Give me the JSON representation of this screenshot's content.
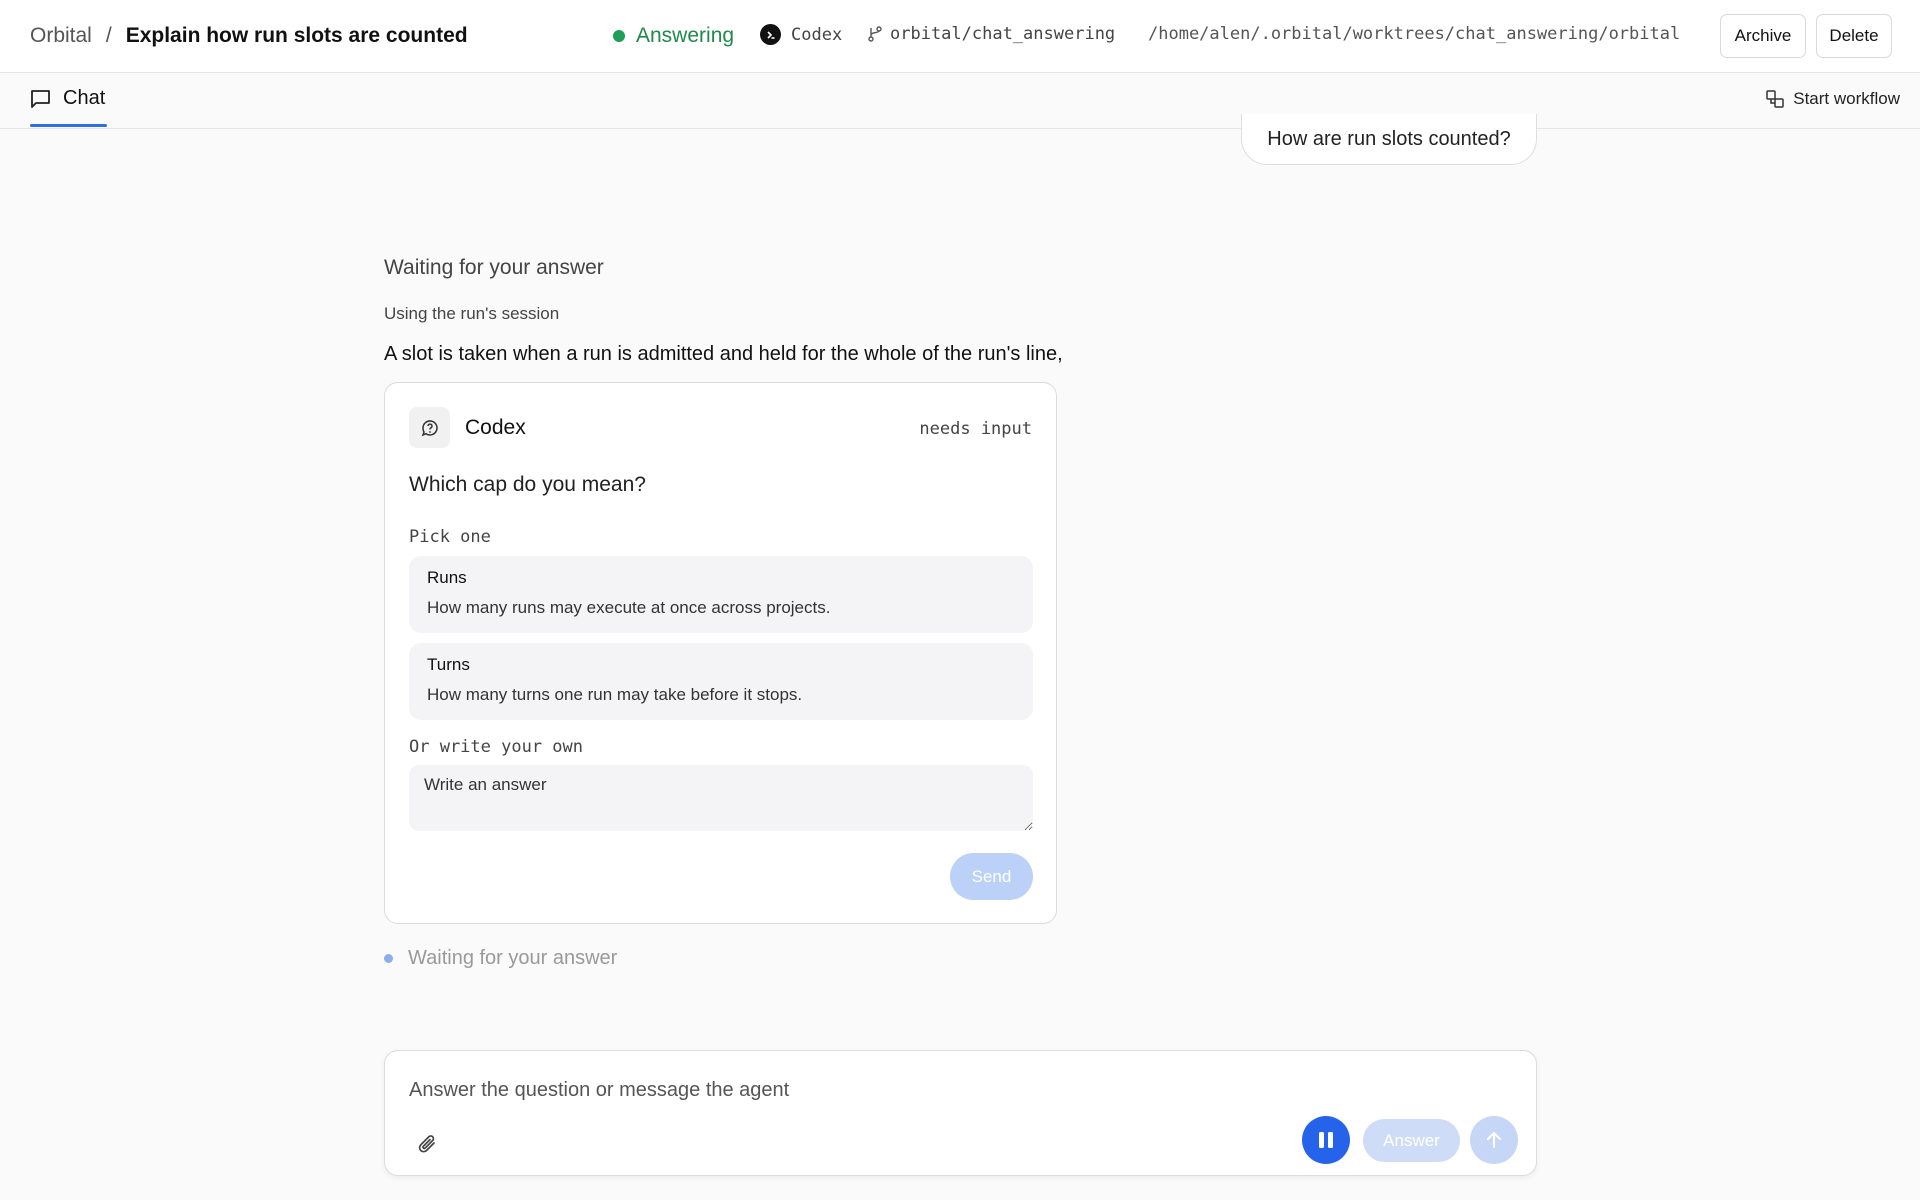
{
  "header": {
    "breadcrumb_root": "Orbital",
    "breadcrumb_sep": "/",
    "title": "Explain how run slots are counted",
    "status": "Answering",
    "agent": "Codex",
    "branch": "orbital/chat_answering",
    "path": "/home/alen/.orbital/worktrees/chat_answering/orbital",
    "archive_label": "Archive",
    "delete_label": "Delete"
  },
  "tabs": {
    "chat_label": "Chat",
    "start_workflow_label": "Start workflow"
  },
  "conversation": {
    "user_message": "How are run slots counted?",
    "waiting_title": "Waiting for your answer",
    "session_note": "Using the run's session",
    "answer_text": "A slot is taken when a run is admitted and held for the whole of the run's line,",
    "waiting_status": "Waiting for your answer"
  },
  "question_card": {
    "agent_name": "Codex",
    "status": "needs input",
    "question": "Which cap do you mean?",
    "pick_label": "Pick one",
    "options": [
      {
        "name": "Runs",
        "description": "How many runs may execute at once across projects."
      },
      {
        "name": "Turns",
        "description": "How many turns one run may take before it stops."
      }
    ],
    "own_label": "Or write your own",
    "own_placeholder": "Write an answer",
    "send_label": "Send"
  },
  "composer": {
    "placeholder": "Answer the question or message the agent",
    "answer_label": "Answer"
  },
  "colors": {
    "accent": "#2563eb",
    "status_green": "#1e8a4c",
    "send_disabled": "#bcd1f7"
  },
  "icons": [
    "codex-icon",
    "branch-icon",
    "chat-icon",
    "workflow-icon",
    "question-icon",
    "paperclip-icon",
    "pause-icon",
    "arrow-up-icon"
  ]
}
